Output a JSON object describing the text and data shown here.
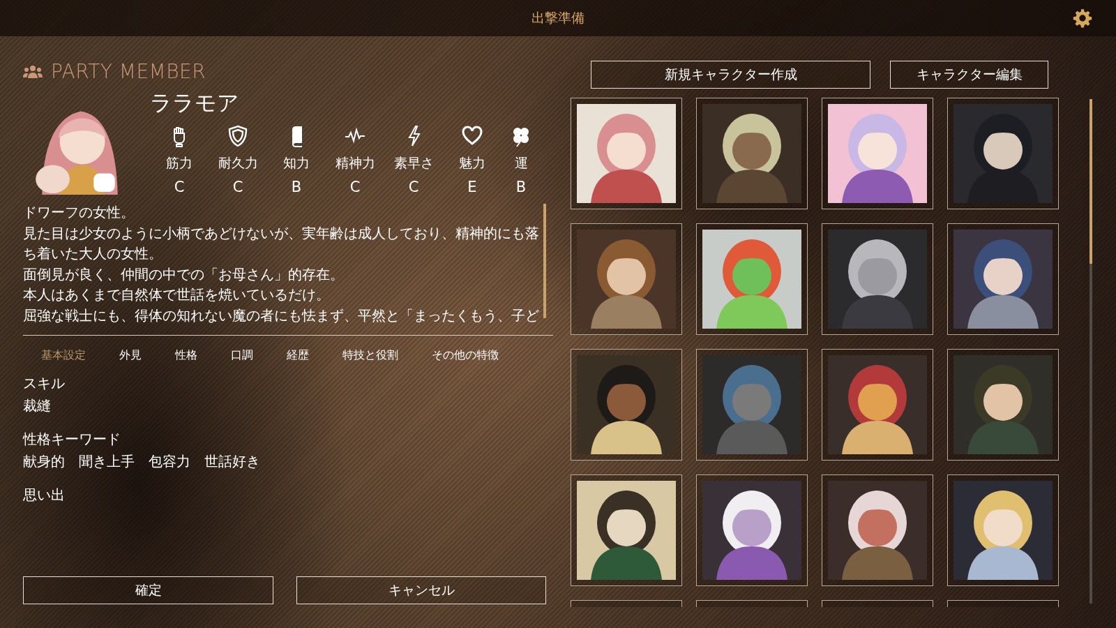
{
  "title_bar": {
    "title": "出撃準備"
  },
  "party": {
    "heading": "PARTY MEMBER",
    "portrait": {
      "kind": "picture"
    },
    "name": "ララモア",
    "stats": [
      {
        "kind": "fist",
        "label": "筋力",
        "grade": "C"
      },
      {
        "kind": "shield",
        "label": "耐久力",
        "grade": "C"
      },
      {
        "kind": "book",
        "label": "知力",
        "grade": "B"
      },
      {
        "kind": "pulse",
        "label": "精神力",
        "grade": "C"
      },
      {
        "kind": "bolt",
        "label": "素早さ",
        "grade": "C"
      },
      {
        "kind": "heart",
        "label": "魅力",
        "grade": "E"
      },
      {
        "kind": "clover",
        "label": "運",
        "grade": "B"
      }
    ],
    "description": [
      "ドワーフの女性。",
      "見た目は少女のように小柄であどけないが、実年齢は成人しており、精神的にも落ち着いた大人の女性。",
      "面倒見が良く、仲間の中での「お母さん」的存在。",
      "本人はあくまで自然体で世話を焼いているだけ。",
      "屈強な戦士にも、得体の知れない魔の者にも怯まず、平然と「まったくもう、子ど"
    ],
    "tabs": [
      {
        "label": "基本設定",
        "selected": true
      },
      {
        "label": "外見",
        "selected": false
      },
      {
        "label": "性格",
        "selected": false
      },
      {
        "label": "口調",
        "selected": false
      },
      {
        "label": "経歴",
        "selected": false
      },
      {
        "label": "特技と役割",
        "selected": false
      },
      {
        "label": "その他の特徴",
        "selected": false
      }
    ],
    "sections": [
      {
        "heading": "スキル",
        "values": [
          "裁縫"
        ]
      },
      {
        "heading": "性格キーワード",
        "values": [
          "献身的",
          "聞き上手",
          "包容力",
          "世話好き"
        ]
      },
      {
        "heading": "思い出"
      }
    ],
    "buttons": [
      "確定",
      "キャンセル"
    ]
  },
  "roster": {
    "buttons": [
      "新規キャラクター作成",
      "キャラクター編集"
    ],
    "tiles": [
      {
        "kind": "picture"
      },
      {
        "kind": "picture"
      },
      {
        "kind": "picture"
      },
      {
        "kind": "picture"
      },
      {
        "kind": "picture"
      },
      {
        "kind": "picture"
      },
      {
        "kind": "picture"
      },
      {
        "kind": "picture"
      },
      {
        "kind": "picture"
      },
      {
        "kind": "picture"
      },
      {
        "kind": "picture"
      },
      {
        "kind": "picture"
      },
      {
        "kind": "picture"
      },
      {
        "kind": "picture"
      },
      {
        "kind": "picture"
      },
      {
        "kind": "picture"
      },
      {
        "kind": "cut"
      },
      {
        "kind": "cut"
      },
      {
        "kind": "cut"
      },
      {
        "kind": "cut"
      }
    ]
  }
}
